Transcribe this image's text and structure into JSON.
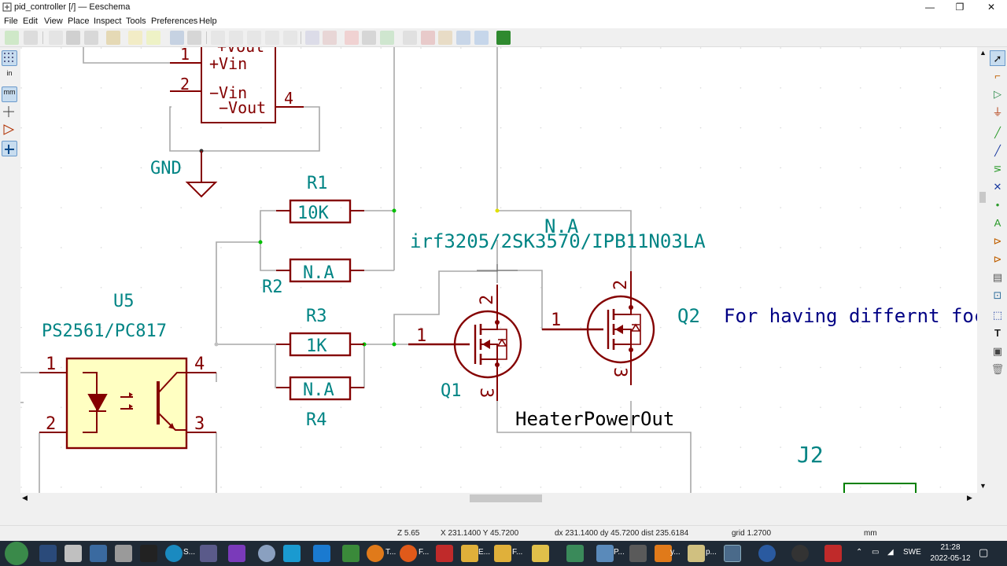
{
  "window": {
    "title": "pid_controller [/] — Eeschema",
    "minimize": "—",
    "maximize": "❐",
    "close": "✕"
  },
  "menu": [
    "File",
    "Edit",
    "View",
    "Place",
    "Inspect",
    "Tools",
    "Preferences",
    "Help"
  ],
  "left_toolbar": {
    "grid_icon": "grid-icon",
    "units_in": "in",
    "units_mm": "mm"
  },
  "schematic": {
    "pin_1a": "1",
    "plus_vin": "+Vin",
    "plus_vout": "+Vout",
    "pin_2a": "2",
    "minus_vin": "−Vin",
    "minus_vout": "−Vout",
    "pin_4a": "4",
    "gnd": "GND",
    "r1_ref": "R1",
    "r1_val": "10K",
    "r2_ref": "R2",
    "r2_val": "N.A",
    "r3_ref": "R3",
    "r3_val": "1K",
    "r4_ref": "R4",
    "r4_val": "N.A",
    "u5_ref": "U5",
    "u5_val": "PS2561/PC817",
    "u5_pin1": "1",
    "u5_pin2": "2",
    "u5_pin3": "3",
    "u5_pin4": "4",
    "q1_ref": "Q1",
    "q1_val": "irf3205/2SK3570/IPB11N03LA",
    "q1_pin1": "1",
    "q1_pin2": "2",
    "q1_pin3": "3",
    "q2_ref": "Q2",
    "q2_val": "N.A",
    "q2_pin1": "1",
    "q2_pin2": "2",
    "q2_pin3": "3",
    "note": "For having differnt foc",
    "net_label": "HeaterPowerOut",
    "j2_ref": "J2"
  },
  "status": {
    "zoom": "Z 5.65",
    "xy": "X 231.1400  Y 45.7200",
    "delta": "dx 231.1400  dy 45.7200  dist 235.6184",
    "grid": "grid 1.2700",
    "units": "mm"
  },
  "taskbar": {
    "labels": [
      "S...",
      "T...",
      "F...",
      "E...",
      "F...",
      "y...",
      "P...",
      "p..."
    ],
    "lang": "SWE",
    "time": "21:28",
    "date": "2022-05-12"
  },
  "colors": {
    "wire": "#a0a0a0",
    "symbol": "#840000",
    "ref_text": "#008484",
    "note_text": "#000084",
    "body_fill": "#ffffc2",
    "junction": "#00c000"
  }
}
